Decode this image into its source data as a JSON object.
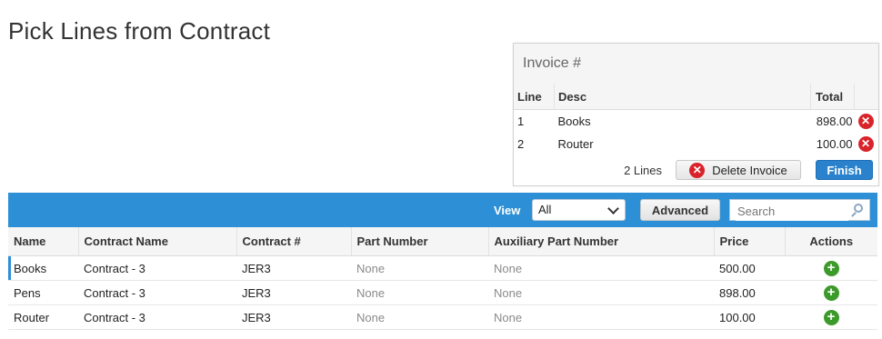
{
  "page": {
    "title": "Pick Lines from Contract"
  },
  "invoice": {
    "title": "Invoice #",
    "columns": {
      "line": "Line",
      "desc": "Desc",
      "total": "Total"
    },
    "rows": [
      {
        "line": "1",
        "desc": "Books",
        "total": "898.00"
      },
      {
        "line": "2",
        "desc": "Router",
        "total": "100.00"
      }
    ],
    "line_count": "2 Lines",
    "delete_label": "Delete Invoice",
    "finish_label": "Finish"
  },
  "toolbar": {
    "view_label": "View",
    "view_value": "All",
    "advanced_label": "Advanced",
    "search_placeholder": "Search"
  },
  "grid": {
    "columns": {
      "name": "Name",
      "contract_name": "Contract Name",
      "contract_no": "Contract #",
      "part_number": "Part Number",
      "aux_part_number": "Auxiliary Part Number",
      "price": "Price",
      "actions": "Actions"
    },
    "rows": [
      {
        "name": "Books",
        "contract_name": "Contract - 3",
        "contract_no": "JER3",
        "part_number": "None",
        "aux_part_number": "None",
        "price": "500.00"
      },
      {
        "name": "Pens",
        "contract_name": "Contract - 3",
        "contract_no": "JER3",
        "part_number": "None",
        "aux_part_number": "None",
        "price": "898.00"
      },
      {
        "name": "Router",
        "contract_name": "Contract - 3",
        "contract_no": "JER3",
        "part_number": "None",
        "aux_part_number": "None",
        "price": "100.00"
      }
    ]
  },
  "colors": {
    "accent": "#2d8fd5",
    "delete": "#d9232a",
    "add": "#3c9a2a",
    "finish": "#2a82cc"
  },
  "icons": {
    "delete": "remove-circle-icon",
    "add": "add-circle-icon",
    "search": "search-icon",
    "dropdown": "chevron-down-icon"
  }
}
